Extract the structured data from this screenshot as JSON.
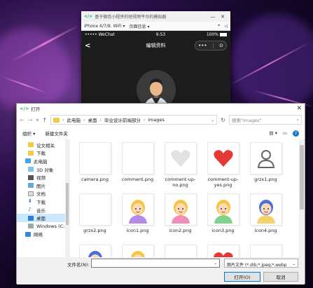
{
  "simulator": {
    "window_title": "基于微信小程序的短视频平台的模拟器",
    "device": "iPhone 6/7/8. WiFi",
    "page_info": "页面信息",
    "status": {
      "signal": "••••• WeChat",
      "time": "9:53",
      "battery": "100%"
    },
    "nav_title": "编辑资料",
    "back": "<",
    "capsule_more": "•••",
    "capsule_close": "⊙"
  },
  "dialog": {
    "title": "打开",
    "close": "✕",
    "breadcrumb": [
      "此电脑",
      "桌面",
      "毕业设计前端部分",
      "images"
    ],
    "search_placeholder": "搜索\"images\"",
    "organize": "组织 ▾",
    "new_folder": "新建文件夹",
    "sidebar": [
      {
        "label": "论文相关",
        "icon": "folder",
        "indent": true
      },
      {
        "label": "下载",
        "icon": "folder",
        "indent": true
      },
      {
        "label": "此电脑",
        "icon": "computer",
        "indent": false
      },
      {
        "label": "3D 对象",
        "icon": "3d",
        "indent": true
      },
      {
        "label": "视频",
        "icon": "video",
        "indent": true
      },
      {
        "label": "图片",
        "icon": "picture",
        "indent": true
      },
      {
        "label": "文档",
        "icon": "document",
        "indent": true
      },
      {
        "label": "下载",
        "icon": "download",
        "indent": true
      },
      {
        "label": "音乐",
        "icon": "music",
        "indent": true
      },
      {
        "label": "桌面",
        "icon": "desktop",
        "indent": true,
        "selected": true
      },
      {
        "label": "Windows (C:)",
        "icon": "drive",
        "indent": true
      },
      {
        "label": "网络",
        "icon": "network",
        "indent": false
      }
    ],
    "files": [
      {
        "name": "camera.png",
        "kind": "blank"
      },
      {
        "name": "comment.png",
        "kind": "blank"
      },
      {
        "name": "comment-up-no.png",
        "kind": "heart-grey"
      },
      {
        "name": "comment-up-yes.png",
        "kind": "heart-red"
      },
      {
        "name": "grzx1.png",
        "kind": "user-outline"
      },
      {
        "name": "grzx2.png",
        "kind": "blank"
      },
      {
        "name": "icon1.png",
        "kind": "avatar-yellow-purple"
      },
      {
        "name": "icon2.png",
        "kind": "avatar-yellow-pink"
      },
      {
        "name": "icon3.png",
        "kind": "avatar-yellow-green"
      },
      {
        "name": "icon4.png",
        "kind": "avatar-blue"
      },
      {
        "name": "",
        "kind": "avatar-blue-partial"
      },
      {
        "name": "",
        "kind": "avatar-yellow-partial"
      },
      {
        "name": "",
        "kind": "blank"
      },
      {
        "name": "",
        "kind": "heart-red-partial"
      },
      {
        "name": "",
        "kind": "blank"
      }
    ],
    "filename_label": "文件名(N):",
    "filename_value": "",
    "filetype": "图片文件 (*.dib;*.jpeg;*.webp",
    "open_button": "打开(O)",
    "cancel_button": "取消"
  },
  "colors": {
    "accent": "#0078d7",
    "heart_red": "#e53935",
    "heart_grey": "#e2e2e2",
    "hair_yellow": "#f5c542",
    "hair_blue": "#4a72d6"
  }
}
